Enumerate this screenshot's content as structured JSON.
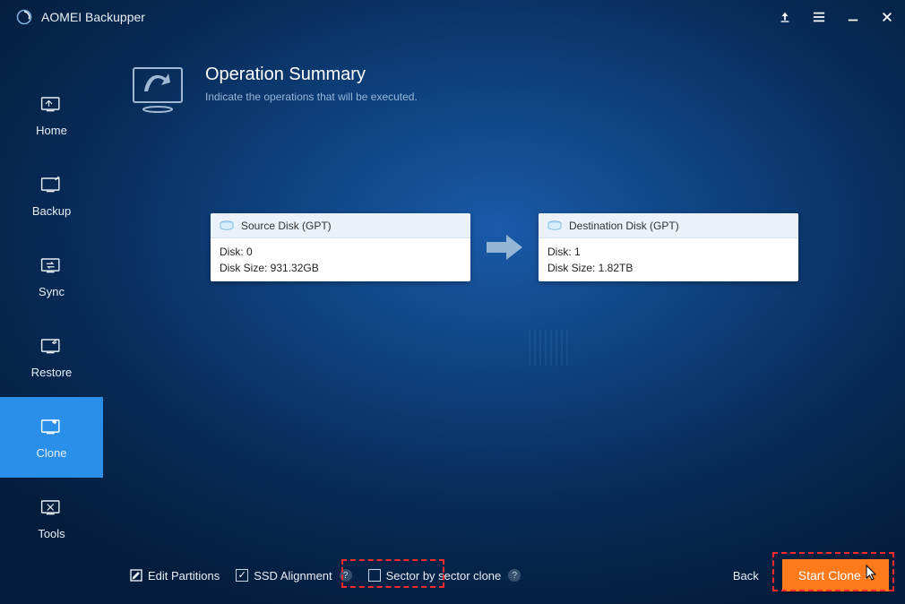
{
  "app": {
    "title": "AOMEI Backupper"
  },
  "sidebar": {
    "items": [
      {
        "label": "Home"
      },
      {
        "label": "Backup"
      },
      {
        "label": "Sync"
      },
      {
        "label": "Restore"
      },
      {
        "label": "Clone"
      },
      {
        "label": "Tools"
      }
    ],
    "active_index": 4
  },
  "header": {
    "title": "Operation Summary",
    "subtitle": "Indicate the operations that will be executed."
  },
  "source_disk": {
    "title": "Source Disk (GPT)",
    "line1": "Disk: 0",
    "line2": "Disk Size: 931.32GB"
  },
  "destination_disk": {
    "title": "Destination Disk (GPT)",
    "line1": "Disk: 1",
    "line2": "Disk Size: 1.82TB"
  },
  "footer": {
    "edit_partitions": "Edit Partitions",
    "ssd_alignment": "SSD Alignment",
    "sector_clone": "Sector by sector clone",
    "back": "Back",
    "start": "Start Clone ››",
    "ssd_checked": true,
    "sector_checked": false
  },
  "colors": {
    "accent": "#ff7a1a",
    "active_nav": "#2a8fe8"
  }
}
